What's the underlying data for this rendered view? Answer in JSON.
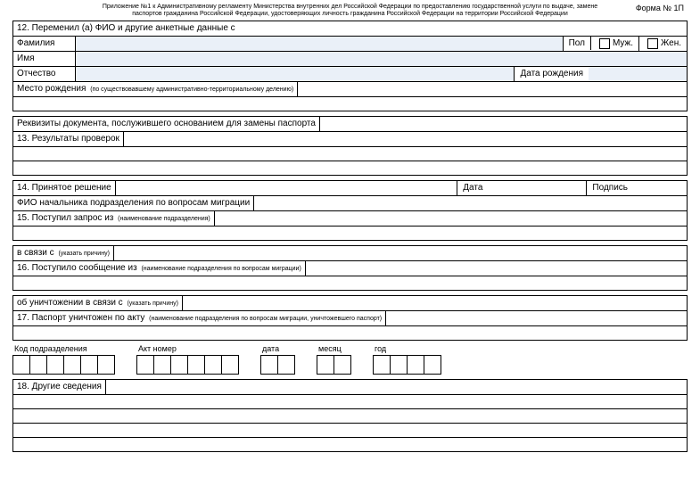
{
  "header": {
    "line1": "Приложение №1 к Административному регламенту Министерства внутренних дел Российской Федерации по предоставлению государственной услуги по выдаче, замене",
    "line2": "паспортов гражданина Российской Федерации, удостоверяющих личность гражданина Российской Федерации на территории Российской Федерации",
    "form_no": "Форма № 1П"
  },
  "section12": {
    "title": "12. Переменил (а) ФИО и другие анкетные данные с",
    "surname_label": "Фамилия",
    "name_label": "Имя",
    "patronymic_label": "Отчество",
    "sex_label": "Пол",
    "male_label": "Муж.",
    "female_label": "Жен.",
    "dob_label": "Дата рождения",
    "birthplace_label": "Место рождения",
    "birthplace_sub": "(по существовавшему административно-территориальному делению)",
    "doc_requisites": "Реквизиты документа, послужившего основанием для замены паспорта"
  },
  "section13": {
    "title": "13. Результаты проверок"
  },
  "section14": {
    "title": "14. Принятое решение",
    "date_label": "Дата",
    "sign_label": "Подпись",
    "fio_label": "ФИО начальника подразделения по вопросам миграции"
  },
  "section15": {
    "title": "15. Поступил запрос из",
    "title_sub": "(наименование подразделения)",
    "reason_label": "в связи с",
    "reason_sub": "(указать причину)"
  },
  "section16": {
    "title": "16. Поступило сообщение из",
    "title_sub": "(наименование подразделения по вопросам миграции)",
    "destroy_label": "об уничтожении в связи с",
    "destroy_sub": "(указать причину)"
  },
  "section17": {
    "title": "17. Паспорт уничтожен по акту",
    "title_sub": "(наименование подразделения по вопросам миграции, уничтожевшего паспорт)"
  },
  "boxes": {
    "code_label": "Код подразделения",
    "act_label": "Акт номер",
    "date_label": "дата",
    "month_label": "месяц",
    "year_label": "год"
  },
  "section18": {
    "title": "18. Другие сведения"
  }
}
